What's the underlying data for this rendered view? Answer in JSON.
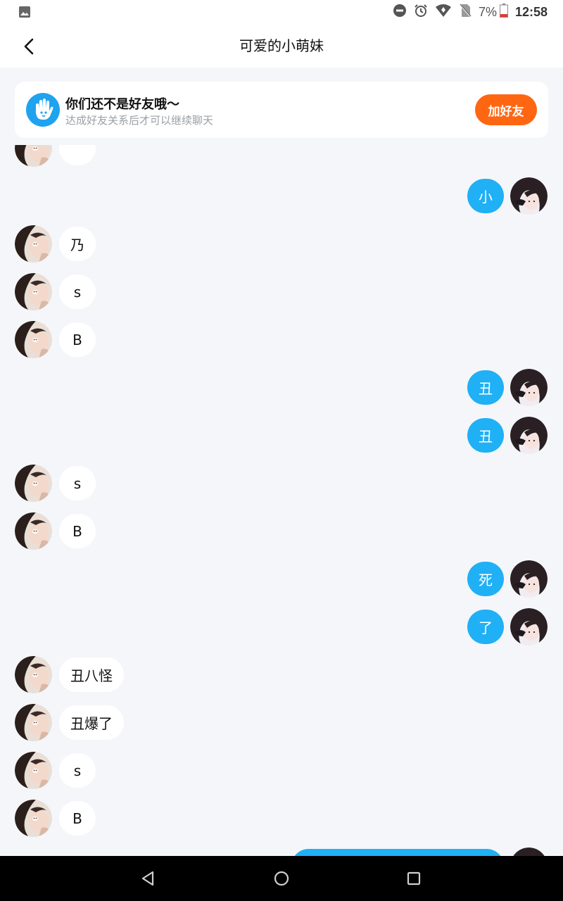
{
  "status_bar": {
    "battery_percent": "7%",
    "time": "12:58",
    "icons": [
      "image-icon",
      "do-not-disturb-icon",
      "alarm-icon",
      "wifi-icon",
      "no-sim-icon",
      "battery-low-icon"
    ]
  },
  "header": {
    "title": "可爱的小萌妹",
    "back_icon": "chevron-left-icon"
  },
  "friend_notice": {
    "title": "你们还不是好友哦～",
    "subtitle": "达成好友关系后才可以继续聊天",
    "button_label": "加好友",
    "icon": "hand-icon",
    "accent_color": "#ff6612",
    "icon_color": "#1fa3ef"
  },
  "messages": [
    {
      "side": "in",
      "text": ""
    },
    {
      "side": "out",
      "text": "小"
    },
    {
      "side": "in",
      "text": "乃"
    },
    {
      "side": "in",
      "text": "s"
    },
    {
      "side": "in",
      "text": "B"
    },
    {
      "side": "out",
      "text": "丑"
    },
    {
      "side": "out",
      "text": "丑"
    },
    {
      "side": "in",
      "text": "s"
    },
    {
      "side": "in",
      "text": "B"
    },
    {
      "side": "out",
      "text": "死"
    },
    {
      "side": "out",
      "text": "了"
    },
    {
      "side": "in",
      "text": "丑八怪"
    },
    {
      "side": "in",
      "text": "丑爆了"
    },
    {
      "side": "in",
      "text": "s"
    },
    {
      "side": "in",
      "text": "B"
    },
    {
      "side": "out",
      "text": ""
    }
  ],
  "colors": {
    "outgoing_bubble": "#20b0f5",
    "incoming_bubble": "#ffffff",
    "background": "#f4f6f9"
  },
  "system_nav": {
    "icons": [
      "back-triangle-icon",
      "home-circle-icon",
      "recents-square-icon"
    ]
  }
}
